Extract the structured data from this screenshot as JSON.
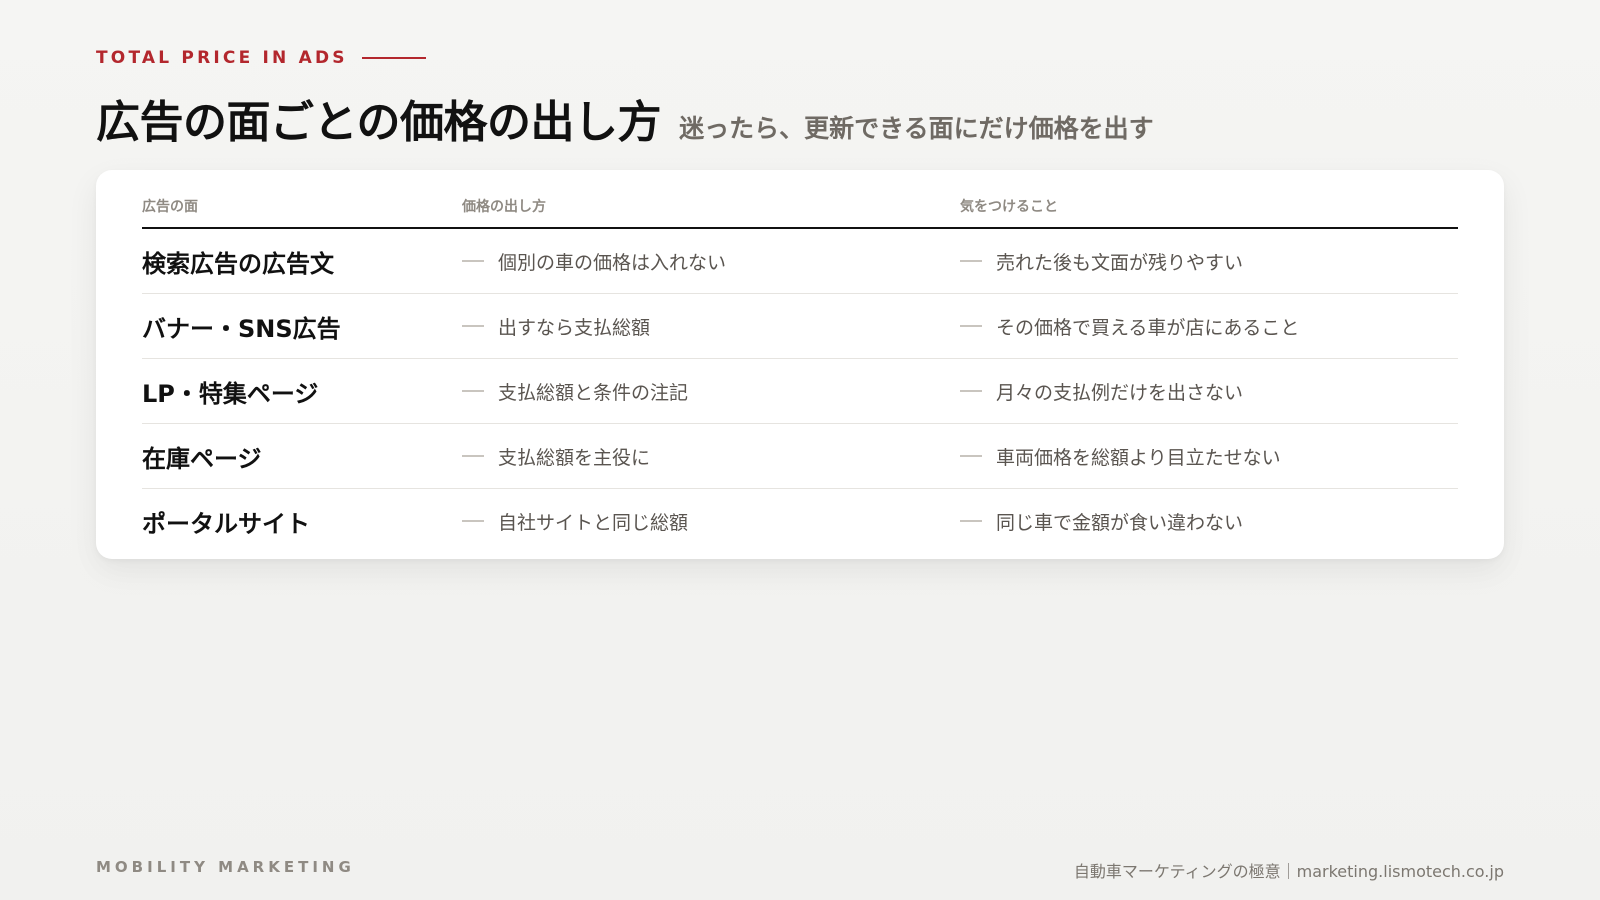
{
  "eyebrow": "TOTAL PRICE IN ADS",
  "title": "広告の面ごとの価格の出し方",
  "subtitle": "迷ったら、更新できる面にだけ価格を出す",
  "table": {
    "headers": [
      "広告の面",
      "価格の出し方",
      "気をつけること"
    ],
    "rows": [
      {
        "surface": "検索広告の広告文",
        "method": "個別の車の価格は入れない",
        "note": "売れた後も文面が残りやすい"
      },
      {
        "surface": "バナー・SNS広告",
        "method": "出すなら支払総額",
        "note": "その価格で買える車が店にあること"
      },
      {
        "surface": "LP・特集ページ",
        "method": "支払総額と条件の注記",
        "note": "月々の支払例だけを出さない"
      },
      {
        "surface": "在庫ページ",
        "method": "支払総額を主役に",
        "note": "車両価格を総額より目立たせない"
      },
      {
        "surface": "ポータルサイト",
        "method": "自社サイトと同じ総額",
        "note": "同じ車で金額が食い違わない"
      }
    ]
  },
  "footer": {
    "left": "MOBILITY MARKETING",
    "right": "自動車マーケティングの極意｜marketing.lismotech.co.jp"
  },
  "colors": {
    "accent": "#b3272d",
    "muted": "#8f8a83",
    "text": "#111111"
  }
}
